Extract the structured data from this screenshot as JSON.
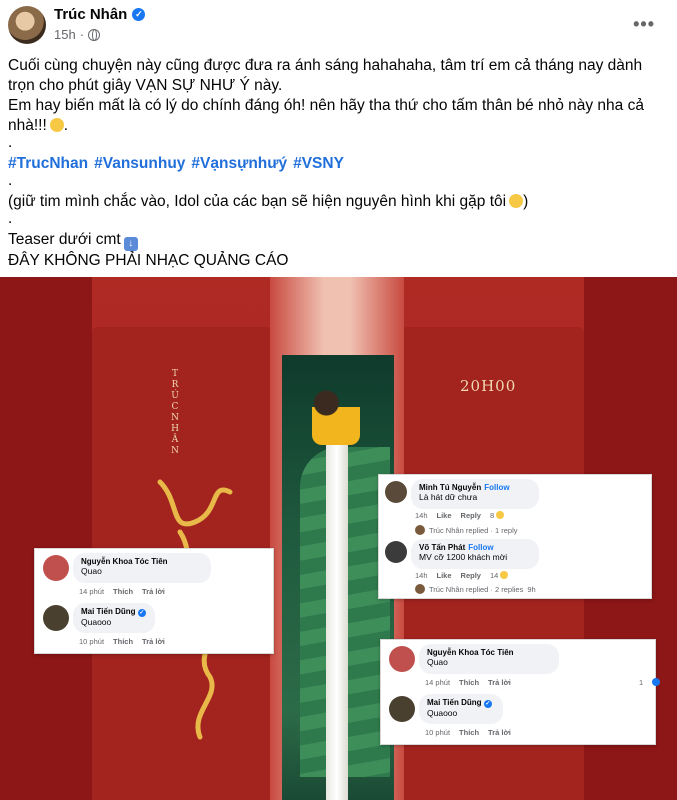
{
  "post": {
    "author": "Trúc Nhân",
    "time": "15h",
    "more_label": "•••",
    "lines": {
      "l1": "Cuối cùng chuyện này cũng được đưa ra ánh sáng hahahaha, tâm trí em cả tháng nay dành trọn cho phút giây VẠN SỰ NHƯ Ý này.",
      "l2": "Em hay biến mất là có lý do chính đáng óh! nên hãy tha thứ cho tấm thân bé nhỏ này nha cả nhà!!!",
      "dot": ".",
      "l3": "(giữ tim mình chắc vào, Idol của các bạn sẽ hiện nguyên hình khi gặp tôi",
      "l3_end": ")",
      "l4": "Teaser dưới cmt",
      "l5": "ĐÂY KHÔNG PHẢI NHẠC QUẢNG CÁO"
    },
    "hashtags": [
      "#TrucNhan",
      "#Vansunhuy",
      "#Vạnsựnhưý",
      "#VSNY"
    ]
  },
  "poster": {
    "vertical_name": "TRÚC NHÂN",
    "time_label": "20H00"
  },
  "comments": {
    "card1": {
      "c1": {
        "name": "Minh Tú Nguyễn",
        "follow": "Follow",
        "text": "Là hát dữ chưa",
        "time": "14h",
        "like": "Like",
        "reply": "Reply",
        "count": "8",
        "replied": "Trúc Nhân replied · 1 reply"
      },
      "c2": {
        "name": "Võ Tấn Phát",
        "follow": "Follow",
        "text": "MV cỡ 1200 khách mời",
        "time": "14h",
        "like": "Like",
        "reply": "Reply",
        "count": "14",
        "replied": "Trúc Nhân replied · 2 replies",
        "replied_time": "9h"
      }
    },
    "card2": {
      "c1": {
        "name": "Nguyễn Khoa Tóc Tiên",
        "text": "Quao",
        "time": "14 phút",
        "like": "Thích",
        "reply": "Trả lời"
      },
      "c2": {
        "name": "Mai Tiến Dũng",
        "text": "Quaooo",
        "time": "10 phút",
        "like": "Thích",
        "reply": "Trả lời"
      }
    },
    "card3": {
      "c1": {
        "name": "Nguyễn Khoa Tóc Tiên",
        "text": "Quao",
        "time": "14 phút",
        "like": "Thích",
        "reply": "Trả lời",
        "count": "1"
      },
      "c2": {
        "name": "Mai Tiến Dũng",
        "text": "Quaooo",
        "time": "10 phút",
        "like": "Thích",
        "reply": "Trả lời"
      }
    }
  },
  "colors": {
    "hashtag": "#216fdb",
    "verified": "#1877f2",
    "poster_red": "#a3231f",
    "poster_green": "#1f5a3e"
  },
  "icons": [
    "verified-badge-icon",
    "globe-icon",
    "more-icon",
    "rofl-emoji-icon",
    "smile-emoji-icon",
    "down-arrow-emoji-icon"
  ]
}
